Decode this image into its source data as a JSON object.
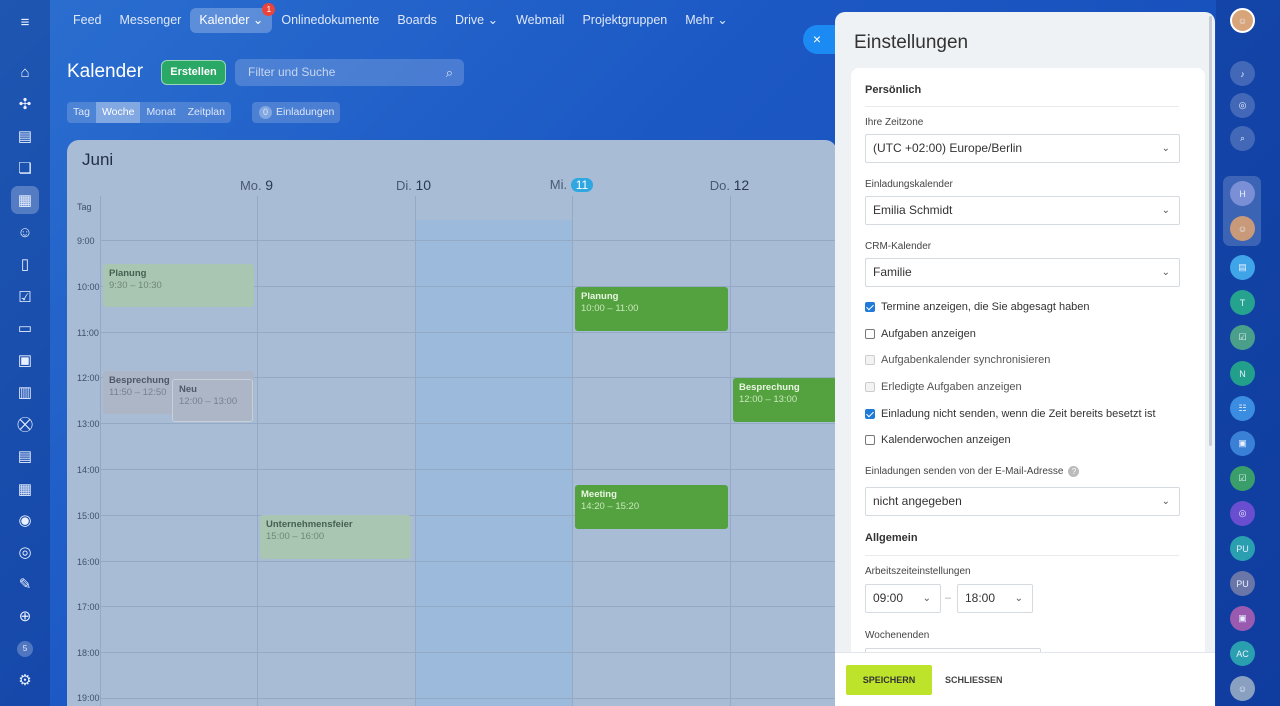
{
  "topnav": {
    "items": [
      "Feed",
      "Messenger",
      "Kalender",
      "Onlinedokumente",
      "Boards",
      "Drive",
      "Webmail",
      "Projektgruppen",
      "Mehr"
    ],
    "kalender_badge": "1",
    "colors": {
      "accent": "#1b8af2",
      "badge": "#e8453c"
    }
  },
  "header": {
    "title": "Kalender",
    "create_label": "Erstellen",
    "search_placeholder": "Filter und Suche"
  },
  "views": {
    "tabs": [
      "Tag",
      "Woche",
      "Monat",
      "Zeitplan"
    ],
    "selected": "Woche",
    "invitations_count": "0",
    "invitations_label": "Einladungen"
  },
  "calendar": {
    "month": "Juni",
    "days": [
      {
        "name": "Mo.",
        "num": "9"
      },
      {
        "name": "Di.",
        "num": "10"
      },
      {
        "name": "Mi.",
        "num": "11"
      },
      {
        "name": "Do.",
        "num": "12"
      }
    ],
    "allday_label": "Tag",
    "times": [
      "9:00",
      "10:00",
      "11:00",
      "12:00",
      "13:00",
      "14:00",
      "15:00",
      "16:00",
      "17:00",
      "18:00",
      "19:00"
    ],
    "events": [
      {
        "title": "Planung",
        "time": "9:30 – 10:30"
      },
      {
        "title": "Besprechung",
        "time": "11:50 – 12:50"
      },
      {
        "title": "Neu",
        "time": "12:00 – 13:00"
      },
      {
        "title": "Unternehmensfeier",
        "time": "15:00 – 16:00"
      },
      {
        "title": "Planung",
        "time": "10:00 – 11:00"
      },
      {
        "title": "Meeting",
        "time": "14:20 – 15:20"
      },
      {
        "title": "Besprechung",
        "time": "12:00 – 13:00"
      }
    ]
  },
  "panel": {
    "title": "Einstellungen",
    "close_icon": "×",
    "personal": {
      "heading": "Persönlich",
      "timezone_label": "Ihre Zeitzone",
      "timezone_value": "(UTC +02:00) Europe/Berlin",
      "invite_cal_label": "Einladungskalender",
      "invite_cal_value": "Emilia Schmidt",
      "crm_label": "CRM-Kalender",
      "crm_value": "Familie",
      "checkboxes": [
        {
          "label": "Termine anzeigen, die Sie abgesagt haben",
          "checked": true
        },
        {
          "label": "Aufgaben anzeigen",
          "checked": false
        },
        {
          "label": "Aufgabenkalender synchronisieren",
          "checked": false
        },
        {
          "label": "Erledigte Aufgaben anzeigen",
          "checked": false
        },
        {
          "label": "Einladung nicht senden, wenn die Zeit bereits besetzt ist",
          "checked": true
        },
        {
          "label": "Kalenderwochen anzeigen",
          "checked": false
        }
      ],
      "email_label": "Einladungen senden von der E-Mail-Adresse",
      "email_value": "nicht angegeben"
    },
    "general": {
      "heading": "Allgemein",
      "worktime_label": "Arbeitszeiteinstellungen",
      "from": "09:00",
      "to": "18:00",
      "weekends_label": "Wochenenden"
    },
    "footer": {
      "save": "SPEICHERN",
      "close": "SCHLIESSEN"
    }
  },
  "rightbar": {
    "avatars": [
      "H",
      "T",
      "N",
      "PU",
      "PU",
      "AC"
    ]
  },
  "leftbar": {
    "counter": "5"
  }
}
